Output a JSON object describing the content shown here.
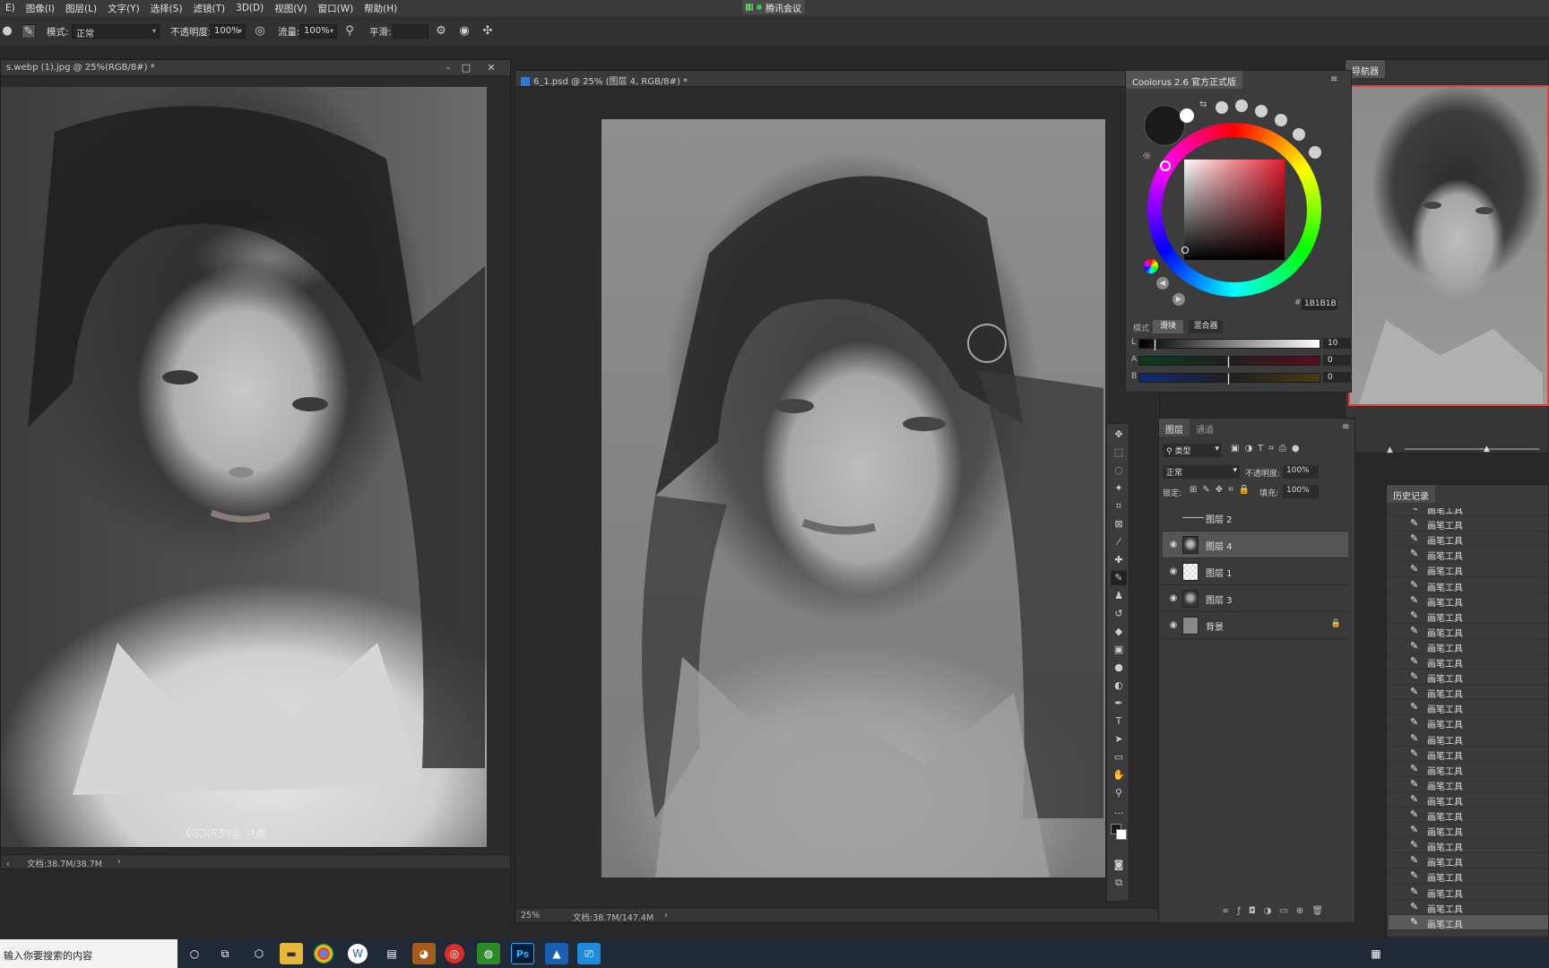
{
  "menubar": {
    "items": [
      "E)",
      "图像(I)",
      "图层(L)",
      "文字(Y)",
      "选择(S)",
      "滤镜(T)",
      "3D(D)",
      "视图(V)",
      "窗口(W)",
      "帮助(H)"
    ],
    "meeting": "腾讯会议"
  },
  "options": {
    "mode_label": "模式:",
    "mode_value": "正常",
    "opacity_label": "不透明度:",
    "opacity_value": "100%",
    "flow_label": "流量:",
    "flow_value": "100%",
    "smooth_label": "平滑:"
  },
  "doc_left": {
    "title": "s.webp (1).jpg @ 25%(RGB/8#) *",
    "status": "文档:38.7M/38.7M",
    "watermark": "鱼片 @PERIC69"
  },
  "doc_main": {
    "title": "6_1.psd @ 25% (图层 4, RGB/8#) *",
    "zoom": "25%",
    "status": "文档:38.7M/147.4M"
  },
  "coolorus": {
    "title": "Coolorus 2.6 官方正式版",
    "hex": "1B1B1B",
    "mode_label": "模式",
    "tab_sliders": "滑块",
    "tab_mixer": "混合器",
    "sliders": [
      {
        "label": "L",
        "value": "10"
      },
      {
        "label": "A",
        "value": "0"
      },
      {
        "label": "B",
        "value": "0"
      }
    ]
  },
  "navigator": {
    "title": "导航器",
    "zoom_suffix": "%"
  },
  "layers_panel": {
    "tab_layers": "图层",
    "tab_channels": "通道",
    "filter_kind": "类型",
    "blend": "正常",
    "opacity_label": "不透明度:",
    "opacity_value": "100%",
    "lock_label": "锁定:",
    "fill_label": "填充:",
    "fill_value": "100%",
    "layers": [
      {
        "name": "图层 2",
        "visible": false,
        "selected": false
      },
      {
        "name": "图层 4",
        "visible": true,
        "selected": true
      },
      {
        "name": "图层 1",
        "visible": true,
        "selected": false
      },
      {
        "name": "图层 3",
        "visible": true,
        "selected": false
      },
      {
        "name": "背景",
        "visible": true,
        "selected": false,
        "locked": true
      }
    ]
  },
  "history": {
    "title": "历史记录",
    "item_label": "画笔工具",
    "count": 28
  },
  "taskbar": {
    "search_placeholder": "输入你要搜索的内容"
  },
  "colors": {
    "accent_selected_layer": "#555555",
    "foreground_color": "#1B1B1B",
    "navigator_frame": "#E04040"
  }
}
